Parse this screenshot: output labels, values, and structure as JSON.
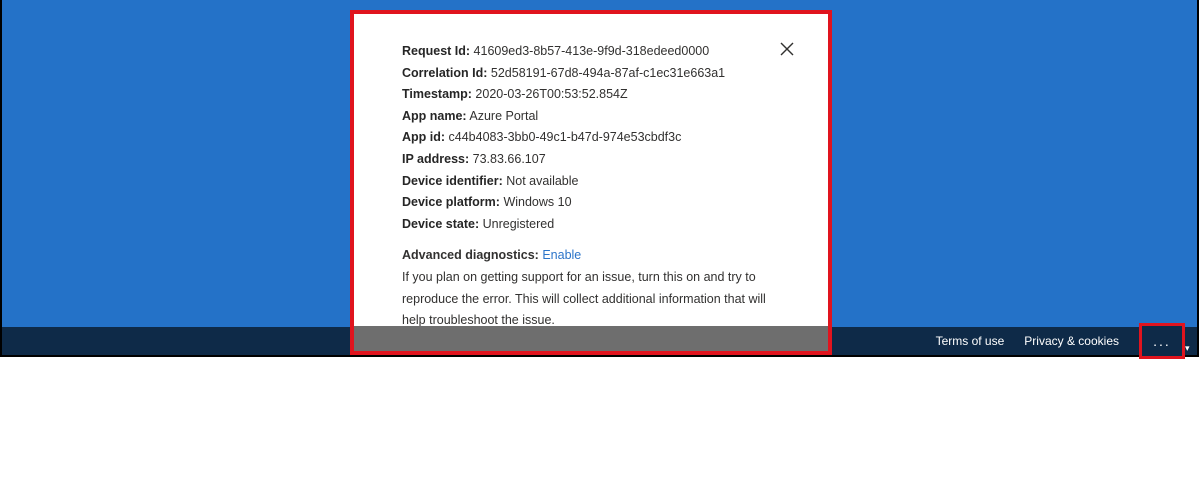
{
  "details": [
    {
      "label": "Request Id:",
      "value": "41609ed3-8b57-413e-9f9d-318edeed0000"
    },
    {
      "label": "Correlation Id:",
      "value": "52d58191-67d8-494a-87af-c1ec31e663a1"
    },
    {
      "label": "Timestamp:",
      "value": "2020-03-26T00:53:52.854Z"
    },
    {
      "label": "App name:",
      "value": "Azure Portal"
    },
    {
      "label": "App id:",
      "value": "c44b4083-3bb0-49c1-b47d-974e53cbdf3c"
    },
    {
      "label": "IP address:",
      "value": "73.83.66.107"
    },
    {
      "label": "Device identifier:",
      "value": "Not available"
    },
    {
      "label": "Device platform:",
      "value": "Windows 10"
    },
    {
      "label": "Device state:",
      "value": "Unregistered"
    }
  ],
  "diagnostics": {
    "label": "Advanced diagnostics:",
    "link": "Enable",
    "description": "If you plan on getting support for an issue, turn this on and try to reproduce the error. This will collect additional information that will help troubleshoot the issue."
  },
  "footer": {
    "terms": "Terms of use",
    "privacy": "Privacy & cookies",
    "more": "..."
  },
  "colors": {
    "background": "#2472c8",
    "footer": "#0e2a48",
    "highlight": "#e0141e",
    "link": "#2b74c9"
  }
}
